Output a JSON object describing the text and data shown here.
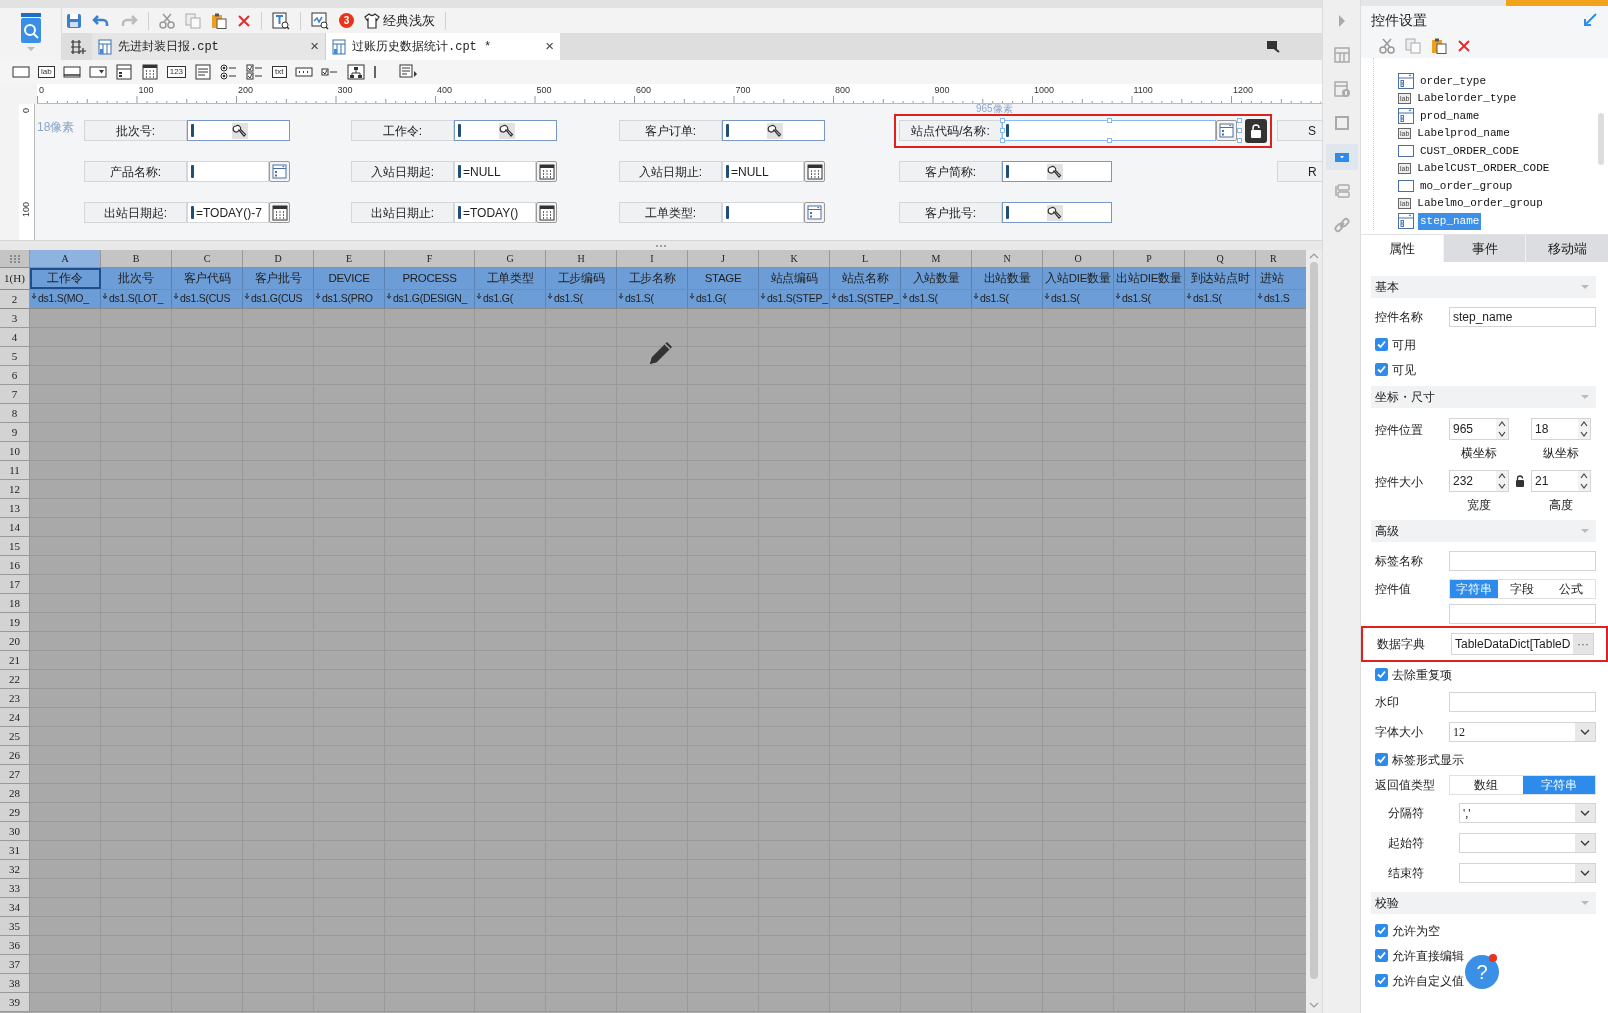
{
  "toolbar": {
    "badge": "3",
    "theme_label": "经典浅灰"
  },
  "file_tabs": [
    {
      "label": "先进封装日报.cpt",
      "close": "×",
      "selected": false
    },
    {
      "label": "过账历史数据统计.cpt *",
      "close": "×",
      "selected": true
    }
  ],
  "widget_tools": [
    {
      "kind": "textbox"
    },
    {
      "kind": "label",
      "glyph": "lab"
    },
    {
      "kind": "button"
    },
    {
      "kind": "combo"
    },
    {
      "kind": "listform"
    },
    {
      "kind": "calendar"
    },
    {
      "kind": "number",
      "glyph": "123"
    },
    {
      "kind": "textarea"
    },
    {
      "kind": "radio"
    },
    {
      "kind": "checkgroup"
    },
    {
      "kind": "text",
      "glyph": "txt"
    },
    {
      "kind": "password"
    },
    {
      "kind": "checkbox"
    },
    {
      "kind": "tree"
    },
    {
      "kind": "divider"
    },
    {
      "kind": "more"
    }
  ],
  "ruler": {
    "marks": [
      "0",
      "100",
      "200",
      "300",
      "400",
      "500",
      "600",
      "700",
      "800",
      "900",
      "1000",
      "1100",
      "1200"
    ],
    "vertical_marks": [
      "0",
      "100"
    ],
    "left_offset": "18像素",
    "top_offset": "965像素"
  },
  "form_rows": [
    [
      {
        "label": "批次号:",
        "kind": "search",
        "selected": false
      },
      {
        "label": "工作令:",
        "kind": "search",
        "selected": false
      },
      {
        "label": "客户订单:",
        "kind": "search",
        "selected": false
      },
      {
        "label": "站点代码/名称:",
        "kind": "dropdown",
        "selected": true,
        "highlighted": true
      },
      {
        "label": "S",
        "kind": "cut",
        "selected": false
      }
    ],
    [
      {
        "label": "产品名称:",
        "kind": "dropdown",
        "selected": false
      },
      {
        "label": "入站日期起:",
        "kind": "date",
        "value": "=NULL",
        "selected": false
      },
      {
        "label": "入站日期止:",
        "kind": "date",
        "value": "=NULL",
        "selected": false
      },
      {
        "label": "客户简称:",
        "kind": "search",
        "selected": false
      },
      {
        "label": "R",
        "kind": "cut",
        "selected": false
      }
    ],
    [
      {
        "label": "出站日期起:",
        "kind": "date",
        "value": "=TODAY()-7",
        "selected": false
      },
      {
        "label": "出站日期止:",
        "kind": "date",
        "value": "=TODAY()",
        "selected": false
      },
      {
        "label": "工单类型:",
        "kind": "dropdown",
        "selected": false
      },
      {
        "label": "客户批号:",
        "kind": "search",
        "selected": false
      }
    ]
  ],
  "sheet": {
    "columns": [
      "A",
      "B",
      "C",
      "D",
      "E",
      "F",
      "G",
      "H",
      "I",
      "J",
      "K",
      "L",
      "M",
      "N",
      "O",
      "P",
      "Q",
      "R"
    ],
    "header_rows": [
      {
        "label": "1(H)",
        "cells": [
          {
            "text": "工作令",
            "selected": true
          },
          {
            "text": "批次号",
            "selected": false
          },
          {
            "text": "客户代码",
            "selected": false
          },
          {
            "text": "客户批号",
            "selected": false
          },
          {
            "text": "DEVICE",
            "selected": false
          },
          {
            "text": "PROCESS",
            "selected": false
          },
          {
            "text": "工单类型",
            "selected": false
          },
          {
            "text": "工步编码",
            "selected": false
          },
          {
            "text": "工步名称",
            "selected": false
          },
          {
            "text": "STAGE",
            "selected": false
          },
          {
            "text": "站点编码",
            "selected": false
          },
          {
            "text": "站点名称",
            "selected": false
          },
          {
            "text": "入站数量",
            "selected": false
          },
          {
            "text": "出站数量",
            "selected": false
          },
          {
            "text": "入站DIE数量",
            "selected": false
          },
          {
            "text": "出站DIE数量",
            "selected": false
          },
          {
            "text": "到达站点时",
            "selected": false
          },
          {
            "text": "进站",
            "selected": false
          }
        ]
      },
      {
        "label": "2",
        "cells": [
          {
            "text": "ds1.S(MO_",
            "selected": false
          },
          {
            "text": "ds1.S(LOT_",
            "selected": false
          },
          {
            "text": "ds1.S(CUS",
            "selected": false
          },
          {
            "text": "ds1.G(CUS",
            "selected": false
          },
          {
            "text": "ds1.S(PRO",
            "selected": false
          },
          {
            "text": "ds1.G(DESIGN_",
            "selected": false
          },
          {
            "text": "ds1.G(",
            "selected": false
          },
          {
            "text": "ds1.S(",
            "selected": false
          },
          {
            "text": "ds1.S(",
            "selected": false
          },
          {
            "text": "ds1.G(",
            "selected": false
          },
          {
            "text": "ds1.S(STEP_",
            "selected": false
          },
          {
            "text": "ds1.S(STEP_",
            "selected": false
          },
          {
            "text": "ds1.S(",
            "selected": false
          },
          {
            "text": "ds1.S(",
            "selected": false
          },
          {
            "text": "ds1.S(",
            "selected": false
          },
          {
            "text": "ds1.S(",
            "selected": false
          },
          {
            "text": "ds1.S(",
            "selected": false
          },
          {
            "text": "ds1.S",
            "selected": false
          }
        ]
      }
    ],
    "row_numbers": [
      "3",
      "4",
      "5",
      "6",
      "7",
      "8",
      "9",
      "10",
      "11",
      "12",
      "13",
      "14",
      "15",
      "16",
      "17",
      "18",
      "19",
      "20",
      "21",
      "22",
      "23",
      "24",
      "25",
      "26",
      "27",
      "28",
      "29",
      "30",
      "31",
      "32",
      "33",
      "34",
      "35",
      "36",
      "37",
      "38",
      "39"
    ]
  },
  "strip_tools": [
    {
      "kind": "collapse",
      "selected": false
    },
    {
      "kind": "layout",
      "selected": false
    },
    {
      "kind": "info",
      "selected": false
    },
    {
      "kind": "frame",
      "selected": false
    },
    {
      "kind": "dropdown",
      "selected": true
    },
    {
      "kind": "fieldset",
      "selected": false
    },
    {
      "kind": "link",
      "selected": false
    }
  ],
  "panel": {
    "title": "控件设置",
    "tree": [
      {
        "kind": "combo",
        "label": "order_type",
        "selected": false
      },
      {
        "kind": "label",
        "glyph": "lab",
        "label": "Labelorder_type",
        "selected": false
      },
      {
        "kind": "combo",
        "label": "prod_name",
        "selected": false
      },
      {
        "kind": "label",
        "glyph": "lab",
        "label": "Labelprod_name",
        "selected": false
      },
      {
        "kind": "textbox",
        "label": "CUST_ORDER_CODE",
        "selected": false
      },
      {
        "kind": "label",
        "glyph": "lab",
        "label": "LabelCUST_ORDER_CODE",
        "selected": false
      },
      {
        "kind": "textbox",
        "label": "mo_order_group",
        "selected": false
      },
      {
        "kind": "label",
        "glyph": "lab",
        "label": "Labelmo_order_group",
        "selected": false
      },
      {
        "kind": "combo",
        "label": "step_name",
        "selected": true
      }
    ],
    "tabs": [
      {
        "label": "属性",
        "selected": true
      },
      {
        "label": "事件",
        "selected": false
      },
      {
        "label": "移动端",
        "selected": false
      }
    ],
    "properties": [
      {
        "kind": "section",
        "label": "基本"
      },
      {
        "kind": "field",
        "label": "控件名称",
        "value": "step_name"
      },
      {
        "kind": "checkbox",
        "label": "可用",
        "checked": true
      },
      {
        "kind": "checkbox",
        "label": "可见",
        "checked": true
      },
      {
        "kind": "section",
        "label": "坐标・尺寸"
      },
      {
        "kind": "spinners",
        "label": "控件位置",
        "lock": false,
        "items": [
          {
            "value": "965",
            "caption": "横坐标"
          },
          {
            "value": "18",
            "caption": "纵坐标"
          }
        ]
      },
      {
        "kind": "spinners",
        "label": "控件大小",
        "lock": true,
        "items": [
          {
            "value": "232",
            "caption": "宽度"
          },
          {
            "value": "21",
            "caption": "高度"
          }
        ]
      },
      {
        "kind": "section",
        "label": "高级"
      },
      {
        "kind": "field",
        "label": "标签名称"
      },
      {
        "kind": "segmented",
        "label": "控件值",
        "options": [
          {
            "label": "字符串",
            "selected": true
          },
          {
            "label": "字段",
            "selected": false
          },
          {
            "label": "公式",
            "selected": false
          }
        ]
      },
      {
        "kind": "blank-field"
      },
      {
        "kind": "dictionary",
        "label": "数据字典",
        "value": "TableDataDict[TableD",
        "button": "···",
        "highlighted": true
      },
      {
        "kind": "checkbox",
        "label": "去除重复项",
        "checked": true
      },
      {
        "kind": "field",
        "label": "水印"
      },
      {
        "kind": "dropdown",
        "label": "字体大小",
        "value": "12"
      },
      {
        "kind": "checkbox",
        "label": "标签形式显示",
        "checked": true
      },
      {
        "kind": "segmented",
        "label": "返回值类型",
        "options": [
          {
            "label": "数组",
            "selected": false
          },
          {
            "label": "字符串",
            "selected": true
          }
        ],
        "children": [
          {
            "kind": "dropdown",
            "label": "分隔符",
            "value": "','"
          },
          {
            "kind": "dropdown",
            "label": "起始符"
          },
          {
            "kind": "dropdown",
            "label": "结束符"
          }
        ]
      },
      {
        "kind": "section",
        "label": "校验"
      },
      {
        "kind": "checkbox",
        "label": "允许为空",
        "checked": true
      },
      {
        "kind": "checkbox",
        "label": "允许直接编辑",
        "checked": true
      },
      {
        "kind": "checkbox",
        "label": "允许自定义值",
        "checked": true
      }
    ],
    "help": "?"
  }
}
